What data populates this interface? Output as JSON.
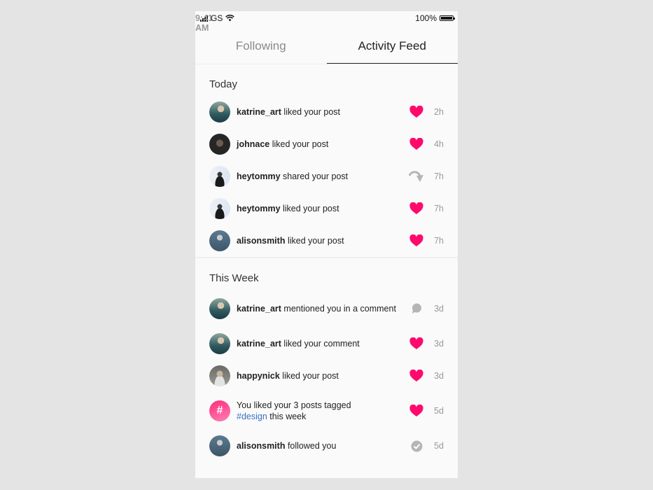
{
  "status_bar": {
    "carrier": "GS",
    "time": "9:41 AM",
    "battery": "100%"
  },
  "tabs": [
    {
      "label": "Following",
      "active": false
    },
    {
      "label": "Activity Feed",
      "active": true
    }
  ],
  "sections": [
    {
      "title": "Today",
      "items": [
        {
          "user": "katrine_art",
          "text": " liked your post",
          "icon": "heart-icon",
          "time": "2h"
        },
        {
          "user": "johnace",
          "text": " liked your post",
          "icon": "heart-icon",
          "time": "4h"
        },
        {
          "user": "heytommy",
          "text": " shared your post",
          "icon": "share-icon",
          "time": "7h"
        },
        {
          "user": "heytommy",
          "text": " liked your post",
          "icon": "heart-icon",
          "time": "7h"
        },
        {
          "user": "alisonsmith",
          "text": " liked your post",
          "icon": "heart-icon",
          "time": "7h"
        }
      ]
    },
    {
      "title": "This Week",
      "items": [
        {
          "user": "katrine_art",
          "text": " mentioned you in a comment",
          "icon": "comment-icon",
          "time": "3d"
        },
        {
          "user": "katrine_art",
          "text": " liked your comment",
          "icon": "heart-icon",
          "time": "3d"
        },
        {
          "user": "happynick",
          "text": " liked your post",
          "icon": "heart-icon",
          "time": "3d"
        },
        {
          "user": "",
          "text": "You liked your 3 posts tagged ",
          "tag": "#design",
          "text_after": " this week",
          "icon": "heart-icon",
          "time": "5d"
        },
        {
          "user": "alisonsmith",
          "text": " followed you",
          "icon": "check-icon",
          "time": "5d"
        }
      ]
    }
  ],
  "colors": {
    "heart": "#ff0a6c",
    "muted_icon": "#b5b5b5",
    "tag": "#3b6fc4"
  }
}
